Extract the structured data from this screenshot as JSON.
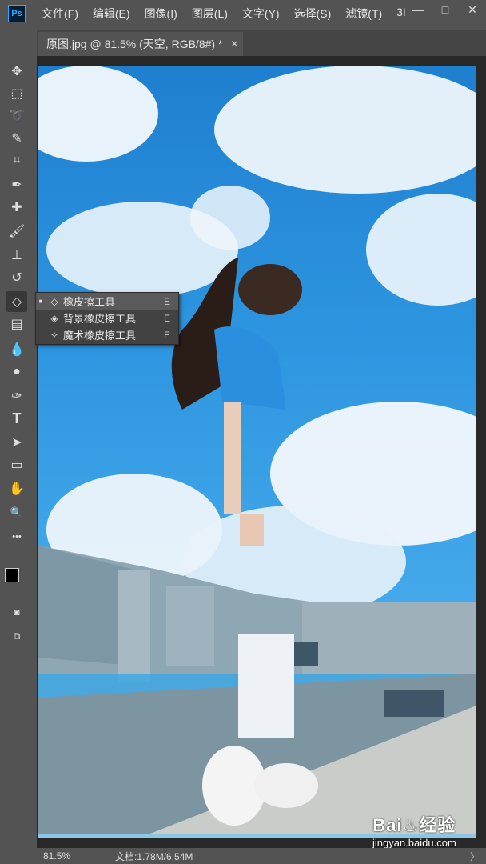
{
  "menubar": {
    "logo": "Ps",
    "items": [
      "文件(F)",
      "编辑(E)",
      "图像(I)",
      "图层(L)",
      "文字(Y)",
      "选择(S)",
      "滤镜(T)",
      "3I"
    ],
    "window_controls": [
      "—",
      "□",
      "✕"
    ]
  },
  "document_tab": {
    "title": "原图.jpg @ 81.5% (天空, RGB/8#) *",
    "close": "✕"
  },
  "toolbar": {
    "tools": [
      {
        "name": "move-tool",
        "glyph": "✥"
      },
      {
        "name": "marquee-tool",
        "glyph": "⬚"
      },
      {
        "name": "lasso-tool",
        "glyph": "➰"
      },
      {
        "name": "quick-select-tool",
        "glyph": "✎"
      },
      {
        "name": "crop-tool",
        "glyph": "⌗"
      },
      {
        "name": "eyedropper-tool",
        "glyph": "✒"
      },
      {
        "name": "healing-brush-tool",
        "glyph": "✚"
      },
      {
        "name": "brush-tool",
        "glyph": "🖌"
      },
      {
        "name": "clone-stamp-tool",
        "glyph": "⊥"
      },
      {
        "name": "history-brush-tool",
        "glyph": "↺"
      },
      {
        "name": "eraser-tool",
        "glyph": "◇"
      },
      {
        "name": "gradient-tool",
        "glyph": "▤"
      },
      {
        "name": "blur-tool",
        "glyph": "💧"
      },
      {
        "name": "dodge-tool",
        "glyph": "●"
      },
      {
        "name": "pen-tool",
        "glyph": "✑"
      },
      {
        "name": "type-tool",
        "glyph": "T"
      },
      {
        "name": "path-select-tool",
        "glyph": "➤"
      },
      {
        "name": "rectangle-tool",
        "glyph": "▭"
      },
      {
        "name": "hand-tool",
        "glyph": "✋"
      },
      {
        "name": "zoom-tool",
        "glyph": "🔍"
      },
      {
        "name": "more-tools",
        "glyph": "•••"
      }
    ],
    "foreground_color": "#000000",
    "background_color": "#ffffff"
  },
  "eraser_flyout": {
    "items": [
      {
        "label": "橡皮擦工具",
        "key": "E",
        "selected": true
      },
      {
        "label": "背景橡皮擦工具",
        "key": "E",
        "selected": false
      },
      {
        "label": "魔术橡皮擦工具",
        "key": "E",
        "selected": false
      }
    ]
  },
  "statusbar": {
    "zoom": "81.5%",
    "doc_info": "文档:1.78M/6.54M",
    "arrow": "〉"
  },
  "watermark": {
    "brand": "Bai♨经验",
    "url": "jingyan.baidu.com"
  }
}
